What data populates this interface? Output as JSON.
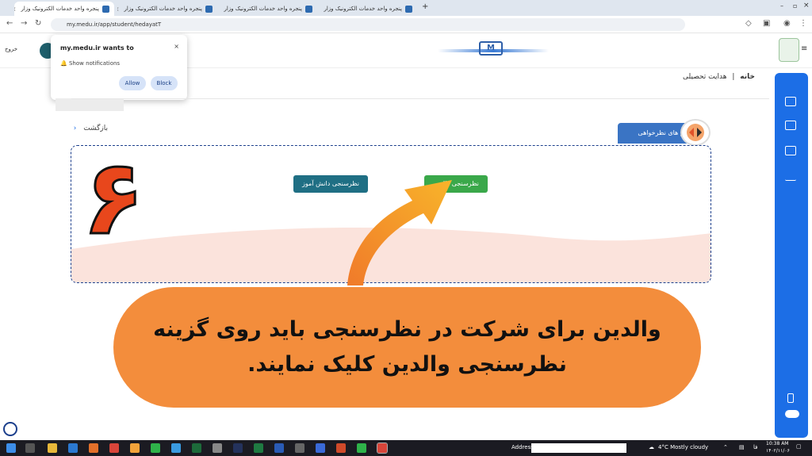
{
  "browser": {
    "tabs": [
      {
        "label": "پنجره واحد خدمات الکترونیک وزار"
      },
      {
        "label": "پنجره واحد خدمات الکترونیک وزار"
      },
      {
        "label": "پنجره واحد خدمات الکترونیک وزار"
      },
      {
        "label": "پنجره واحد خدمات الکترونیک وزار"
      }
    ],
    "new_tab": "+",
    "url": "my.medu.ir/app/student/hedayatT"
  },
  "header": {
    "logout": "خروج"
  },
  "notification": {
    "title": "my.medu.ir wants to",
    "message": "Show notifications",
    "allow": "Allow",
    "block": "Block",
    "close": "×"
  },
  "breadcrumb": {
    "home": "خانه",
    "sep": "|",
    "current": "هدایت تحصیلی"
  },
  "back": "بازگشت",
  "forms_tab": "فرم های نظرخواهی",
  "buttons": {
    "student_survey": "نظرسنجی دانش آموز",
    "parent_survey": "نظرسنجی والدین"
  },
  "step_number": "۶",
  "callout": {
    "line1": "والدین برای شرکت در نظرسنجی باید روی گزینه",
    "line2": "نظرسنجی والدین کلیک نمایند."
  },
  "taskbar": {
    "address_label": "Address",
    "weather": "4°C  Mostly cloudy",
    "lang": "فا",
    "time": "10:38 AM",
    "date": "۱۴۰۲/۱۱/۰۶"
  },
  "colors": {
    "accent": "#1c6ee6",
    "callout": "#f38d3c",
    "parent_btn": "#3aa84a",
    "student_btn": "#1f6f84",
    "number": "#e8471c"
  }
}
